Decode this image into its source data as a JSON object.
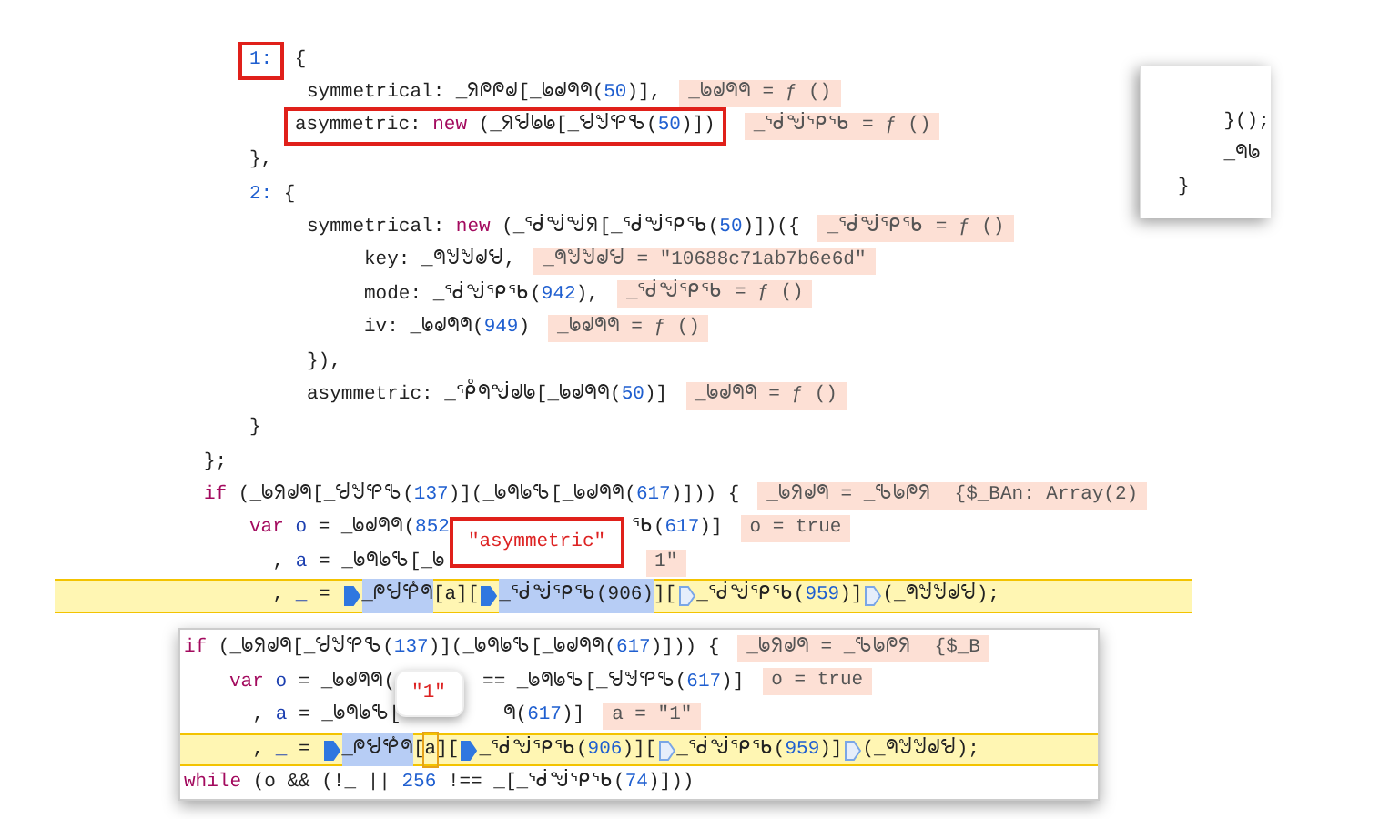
{
  "editor": {
    "lines": [
      {
        "children": [
          {
            "highlighted": false,
            "segments": [
              {
                "kind": "boxed",
                "children": [
                  {
                    "kind": "number",
                    "text": "1:"
                  }
                ]
              },
              {
                "kind": "plain",
                "text": " {"
              }
            ]
          },
          {
            "highlighted": false,
            "segments": [
              {
                "kind": "plain",
                "text": "     symmetrical: _ᖆᖘᖘᖙ[_ᖚᖙᖗᖗ("
              },
              {
                "kind": "number",
                "text": "50"
              },
              {
                "kind": "plain",
                "text": ")],"
              },
              {
                "kind": "value",
                "text": "_ᖚᖙᖗᖗ = ƒ ()"
              }
            ]
          },
          {
            "children": [
              {
                "highlighted": false,
                "segments": [
                  {
                    "kind": "boxed",
                    "children": [
                      {
                        "kind": "plain",
                        "text": "asymmetric: "
                      },
                      {
                        "kind": "keyword",
                        "text": "new"
                      },
                      {
                        "kind": "plain",
                        "text": " (_ᖆᖂᖚᖚ[_ᖂᖒᕿᖃ("
                      },
                      {
                        "kind": "number",
                        "text": "50"
                      },
                      {
                        "kind": "plain",
                        "text": ")])"
                      }
                    ]
                  },
                  {
                    "kind": "value",
                    "text": "_ᖂᖒᕿᖃ = ƒ ()"
                  }
                ]
              }
            ]
          },
          {
            "highlighted": false,
            "segments": [
              {
                "kind": "plain",
                "text": "},"
              }
            ]
          },
          {
            "highlighted": false,
            "segments": [
              {
                "kind": "number",
                "text": "2:"
              },
              {
                "kind": "plain",
                "text": " {"
              }
            ]
          },
          {
            "highlighted": false,
            "segments": [
              {
                "kind": "plain",
                "text": "     symmetrical: "
              },
              {
                "kind": "keyword",
                "text": "new"
              },
              {
                "kind": "plain",
                "text": " (_ᖂᖒᖒᖆ[_ᖂᖒᕿᖃ("
              },
              {
                "kind": "number",
                "text": "50"
              },
              {
                "kind": "plain",
                "text": ")])({"
              },
              {
                "kind": "value",
                "text": "_ᖂᖒᕿᖃ = ƒ ()"
              }
            ]
          },
          {
            "highlighted": false,
            "segments": [
              {
                "kind": "plain",
                "text": "          key: _ᖗᖒᖒᖙᖂ,"
              },
              {
                "kind": "value",
                "text": "_ᖗᖒᖒᖙᖂ = \"10688c71ab7b6e6d\""
              }
            ]
          },
          {
            "highlighted": false,
            "segments": [
              {
                "kind": "plain",
                "text": "          mode: _ᖂᖒᕿᖃ("
              },
              {
                "kind": "number",
                "text": "942"
              },
              {
                "kind": "plain",
                "text": "),"
              },
              {
                "kind": "value",
                "text": "_ᖂᖒᕿᖃ = ƒ ()"
              }
            ]
          },
          {
            "highlighted": false,
            "segments": [
              {
                "kind": "plain",
                "text": "          iv: _ᖚᖙᖗᖗ("
              },
              {
                "kind": "number",
                "text": "949"
              },
              {
                "kind": "plain",
                "text": ")"
              },
              {
                "kind": "value",
                "text": "_ᖚᖙᖗᖗ = ƒ ()"
              }
            ]
          },
          {
            "highlighted": false,
            "segments": [
              {
                "kind": "plain",
                "text": "     }),"
              }
            ]
          },
          {
            "highlighted": false,
            "segments": [
              {
                "kind": "plain",
                "text": "     asymmetric: _ᕾᖗᖒᖙᖚ[_ᖚᖙᖗᖗ("
              },
              {
                "kind": "number",
                "text": "50"
              },
              {
                "kind": "plain",
                "text": ")]"
              },
              {
                "kind": "value",
                "text": "_ᖚᖙᖗᖗ = ƒ ()"
              }
            ]
          },
          {
            "highlighted": false,
            "segments": [
              {
                "kind": "plain",
                "text": "}"
              }
            ]
          }
        ]
      },
      {
        "highlighted": false,
        "segments": [
          {
            "kind": "plain",
            "text": "};"
          }
        ]
      },
      {
        "highlighted": false,
        "segments": [
          {
            "kind": "keyword",
            "text": "if"
          },
          {
            "kind": "plain",
            "text": " (_ᖚᖆᖙᖗ[_ᖂᖒᕿᖃ("
          },
          {
            "kind": "number",
            "text": "137"
          },
          {
            "kind": "plain",
            "text": ")](_ᖚᖗᖚᖃ[_ᖚᖙᖗᖗ("
          },
          {
            "kind": "number",
            "text": "617"
          },
          {
            "kind": "plain",
            "text": ")])) {"
          },
          {
            "kind": "value",
            "text": "_ᖚᖆᖙᖗ = _ᖃᖚᖘᖆ  {$_BAn: Array(2)"
          }
        ]
      },
      {
        "children": [
          {
            "highlighted": false,
            "segments": [
              {
                "kind": "keyword",
                "text": "var"
              },
              {
                "kind": "variable",
                "text": "o"
              },
              {
                "kind": "plain",
                "text": " = _ᖚᖙᖗᖗ("
              },
              {
                "kind": "number",
                "text": "852"
              },
              {
                "kind": "tooltip",
                "text": "\"asymmetric\"",
                "framed": true
              },
              {
                "kind": "plain",
                "text": "ᖃ("
              },
              {
                "kind": "number",
                "text": "617"
              },
              {
                "kind": "plain",
                "text": ")]"
              },
              {
                "kind": "value",
                "text": "o = true"
              }
            ]
          }
        ]
      },
      {
        "highlighted": false,
        "segments": [
          {
            "kind": "plain",
            "text": "      , "
          },
          {
            "kind": "variable",
            "text": "a"
          },
          {
            "kind": "plain",
            "text": " = _ᖚᖗᖚᖃ[_ᖚ"
          },
          {
            "kind": "gap"
          },
          {
            "kind": "value",
            "text": "1\""
          }
        ]
      },
      {
        "highlighted": true,
        "segments": [
          {
            "kind": "plain",
            "text": "      , "
          },
          {
            "kind": "variable",
            "text": "_"
          },
          {
            "kind": "plain",
            "text": " = "
          },
          {
            "kind": "marker",
            "filled": true
          },
          {
            "kind": "selection",
            "text": "_ᖘᖂᕾᖗ"
          },
          {
            "kind": "plain",
            "text": "[a]["
          },
          {
            "kind": "marker",
            "filled": true
          },
          {
            "kind": "selection",
            "text": "_ᖂᖒᕿᖃ(906)"
          },
          {
            "kind": "plain",
            "text": "]["
          },
          {
            "kind": "marker",
            "filled": false
          },
          {
            "kind": "plain",
            "text": "_ᖂᖒᕿᖃ("
          },
          {
            "kind": "number",
            "text": "959"
          },
          {
            "kind": "plain",
            "text": ")]"
          },
          {
            "kind": "marker",
            "filled": false
          },
          {
            "kind": "plain",
            "text": "(_ᖗᖒᖒᖙᖂ);"
          }
        ]
      }
    ]
  },
  "peek_popup": {
    "lines": [
      {
        "highlighted": false,
        "segments": [
          {
            "kind": "plain",
            "text": "    }();"
          }
        ]
      },
      {
        "highlighted": false,
        "segments": [
          {
            "kind": "plain",
            "text": "    _ᖗᖚ"
          }
        ]
      },
      {
        "highlighted": false,
        "segments": [
          {
            "kind": "plain",
            "text": "}"
          }
        ]
      }
    ]
  },
  "inline_popup": {
    "lines": [
      {
        "highlighted": false,
        "segments": [
          {
            "kind": "keyword",
            "text": "if"
          },
          {
            "kind": "plain",
            "text": " (_ᖚᖆᖙᖗ[_ᖂᖒᕿᖃ("
          },
          {
            "kind": "number",
            "text": "137"
          },
          {
            "kind": "plain",
            "text": ")](_ᖚᖗᖚᖃ[_ᖚᖙᖗᖗ("
          },
          {
            "kind": "number",
            "text": "617"
          },
          {
            "kind": "plain",
            "text": ")])) {"
          },
          {
            "kind": "value",
            "text": "_ᖚᖆᖙᖗ = _ᖃᖚᖘᖆ  {$_B"
          }
        ]
      },
      {
        "children": [
          {
            "highlighted": false,
            "segments": [
              {
                "kind": "keyword",
                "text": "var"
              },
              {
                "kind": "variable",
                "text": "o"
              },
              {
                "kind": "plain",
                "text": " = _ᖚᖙᖗᖗ("
              },
              {
                "kind": "tooltip",
                "text": "\"1\"",
                "framed": false
              },
              {
                "kind": "plain",
                "text": "== _ᖚᖗᖚᖃ[_ᖂᖒᕿᖃ("
              },
              {
                "kind": "number",
                "text": "617"
              },
              {
                "kind": "plain",
                "text": ")]"
              },
              {
                "kind": "value",
                "text": "o = true"
              }
            ]
          }
        ]
      },
      {
        "highlighted": false,
        "segments": [
          {
            "kind": "plain",
            "text": "      , "
          },
          {
            "kind": "variable",
            "text": "a"
          },
          {
            "kind": "plain",
            "text": " = _ᖚᖗᖚᖃ["
          },
          {
            "kind": "gap"
          },
          {
            "kind": "plain",
            "text": "ᖗ("
          },
          {
            "kind": "number",
            "text": "617"
          },
          {
            "kind": "plain",
            "text": ")]"
          },
          {
            "kind": "value",
            "text": "a = \"1\""
          }
        ]
      },
      {
        "highlighted": true,
        "segments": [
          {
            "kind": "plain",
            "text": "      , "
          },
          {
            "kind": "variable",
            "text": "_"
          },
          {
            "kind": "plain",
            "text": " = "
          },
          {
            "kind": "marker",
            "filled": true
          },
          {
            "kind": "selection",
            "text": "_ᖘᖂᕾᖗ"
          },
          {
            "kind": "plain",
            "text": "["
          },
          {
            "kind": "cursor",
            "text": "a"
          },
          {
            "kind": "plain",
            "text": "]["
          },
          {
            "kind": "marker",
            "filled": true
          },
          {
            "kind": "plain",
            "text": "_ᖂᖒᕿᖃ("
          },
          {
            "kind": "number",
            "text": "906"
          },
          {
            "kind": "plain",
            "text": ")]["
          },
          {
            "kind": "marker",
            "filled": false
          },
          {
            "kind": "plain",
            "text": "_ᖂᖒᕿᖃ("
          },
          {
            "kind": "number",
            "text": "959"
          },
          {
            "kind": "plain",
            "text": ")]"
          },
          {
            "kind": "marker",
            "filled": false
          },
          {
            "kind": "plain",
            "text": "(_ᖗᖒᖒᖙᖂ);"
          }
        ]
      },
      {
        "highlighted": false,
        "segments": [
          {
            "kind": "keyword",
            "text": "while"
          },
          {
            "kind": "plain",
            "text": " (o && (!_ || "
          },
          {
            "kind": "number",
            "text": "256"
          },
          {
            "kind": "plain",
            "text": " !== _[_ᖂᖒᕿᖃ("
          },
          {
            "kind": "number",
            "text": "74"
          },
          {
            "kind": "plain",
            "text": ")]))"
          }
        ]
      }
    ]
  }
}
